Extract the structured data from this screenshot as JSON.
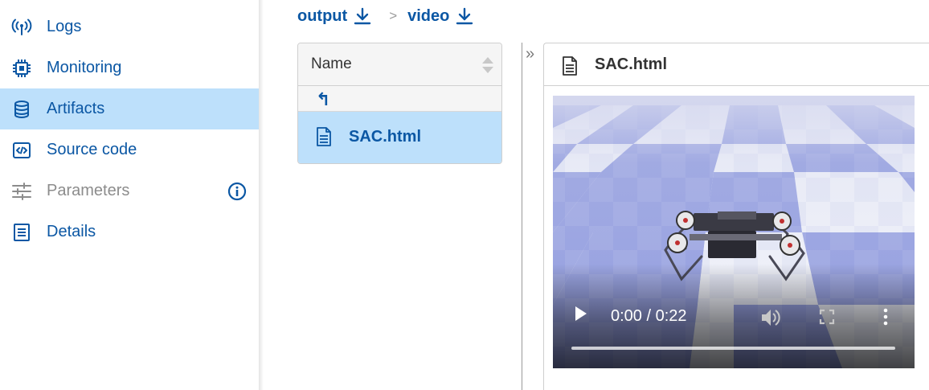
{
  "sidebar": {
    "items": [
      {
        "label": "Logs",
        "icon": "antenna-icon"
      },
      {
        "label": "Monitoring",
        "icon": "chip-icon"
      },
      {
        "label": "Artifacts",
        "icon": "database-icon",
        "active": true
      },
      {
        "label": "Source code",
        "icon": "code-icon"
      },
      {
        "label": "Parameters",
        "icon": "sliders-icon",
        "disabled": true
      },
      {
        "label": "Details",
        "icon": "document-icon"
      }
    ]
  },
  "breadcrumb": {
    "items": [
      {
        "label": "output",
        "icon": "download-icon"
      },
      {
        "label": "video",
        "icon": "download-icon"
      }
    ],
    "separator": ">"
  },
  "file_list": {
    "header": "Name",
    "up_symbol": "↰",
    "files": [
      {
        "name": "SAC.html",
        "icon": "file-icon",
        "selected": true
      }
    ]
  },
  "collapse_symbol": "»",
  "preview": {
    "title": "SAC.html",
    "video": {
      "time": "0:00 / 0:22",
      "progress": 0.0
    }
  },
  "colors": {
    "accent": "#0b57a4",
    "selected_bg": "#bde0fb",
    "disabled_text": "#8c8c8c"
  }
}
